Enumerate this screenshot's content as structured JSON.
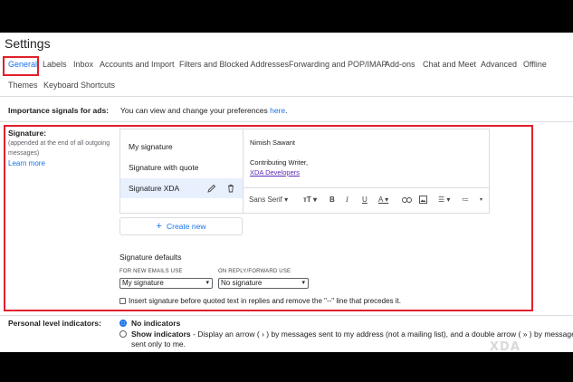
{
  "page_title": "Settings",
  "tabs": [
    {
      "label": "General",
      "active": true
    },
    {
      "label": "Labels"
    },
    {
      "label": "Inbox"
    },
    {
      "label": "Accounts and Import"
    },
    {
      "label": "Filters and Blocked Addresses"
    },
    {
      "label": "Forwarding and POP/IMAP"
    },
    {
      "label": "Add-ons"
    },
    {
      "label": "Chat and Meet"
    },
    {
      "label": "Advanced"
    },
    {
      "label": "Offline"
    },
    {
      "label": "Themes"
    },
    {
      "label": "Keyboard Shortcuts"
    }
  ],
  "importance": {
    "label": "Importance signals for ads:",
    "text": "You can view and change your preferences",
    "link": "here",
    "trail": "."
  },
  "signature": {
    "label": "Signature:",
    "note": "(appended at the end of all outgoing messages)",
    "learn_more": "Learn more",
    "items": [
      "My signature",
      "Signature with quote",
      "Signature XDA"
    ],
    "selected_index": 2,
    "editor": {
      "name": "Nimish Sawant",
      "role": "Contributing Writer,",
      "company_link": "XDA Developers"
    },
    "toolbar": {
      "font": "Sans Serif"
    },
    "create_new": "Create new",
    "defaults_title": "Signature defaults",
    "new_emails_caption": "FOR NEW EMAILS USE",
    "new_emails_value": "My signature",
    "reply_caption": "ON REPLY/FORWARD USE",
    "reply_value": "No signature",
    "insert_before_text": "Insert signature before quoted text in replies and remove the \"--\" line that precedes it."
  },
  "personal_level": {
    "label": "Personal level indicators:",
    "option1": "No indicators",
    "option2_bold": "Show indicators",
    "option2_text": " - Display an arrow ( › ) by messages sent to my address (not a mailing list), and a double arrow ( » ) by messages",
    "option2_line2": "sent only to me."
  },
  "watermark": "XDA",
  "colors": {
    "accent": "#1a73e8",
    "highlight": "#e0202b"
  }
}
